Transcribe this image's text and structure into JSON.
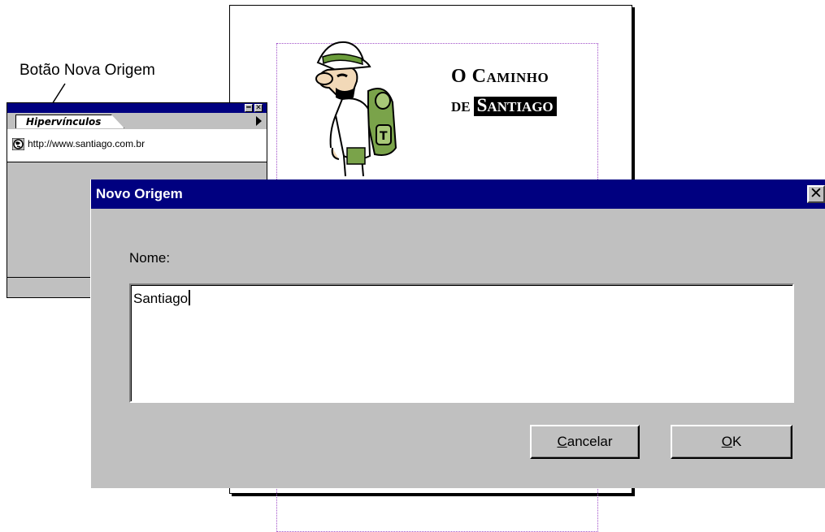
{
  "callout": {
    "label": "Botão Nova Origem"
  },
  "document": {
    "title_line1_cap": "O",
    "title_line1_first": "C",
    "title_line1_rest": "AMINHO",
    "title_line2_prefix": "DE",
    "title_line2_first": "S",
    "title_line2_rest": "ANTIAGO"
  },
  "palette": {
    "minimize_glyph": "━",
    "close_glyph": "✕",
    "tab_label": "Hipervínculos",
    "items": [
      {
        "url": "http://www.santiago.com.br",
        "icon": "globe-anchor-icon"
      }
    ]
  },
  "dialog": {
    "title": "Novo Origem",
    "close_glyph": "✕",
    "field_label": "Nome:",
    "field_value": "Santiago",
    "cancel_mnemonic": "C",
    "cancel_rest": "ancelar",
    "ok_mnemonic": "O",
    "ok_rest": "K"
  },
  "colors": {
    "titlebar": "#000080",
    "face": "#c0c0c0",
    "frame_dotted": "#a050c8"
  }
}
